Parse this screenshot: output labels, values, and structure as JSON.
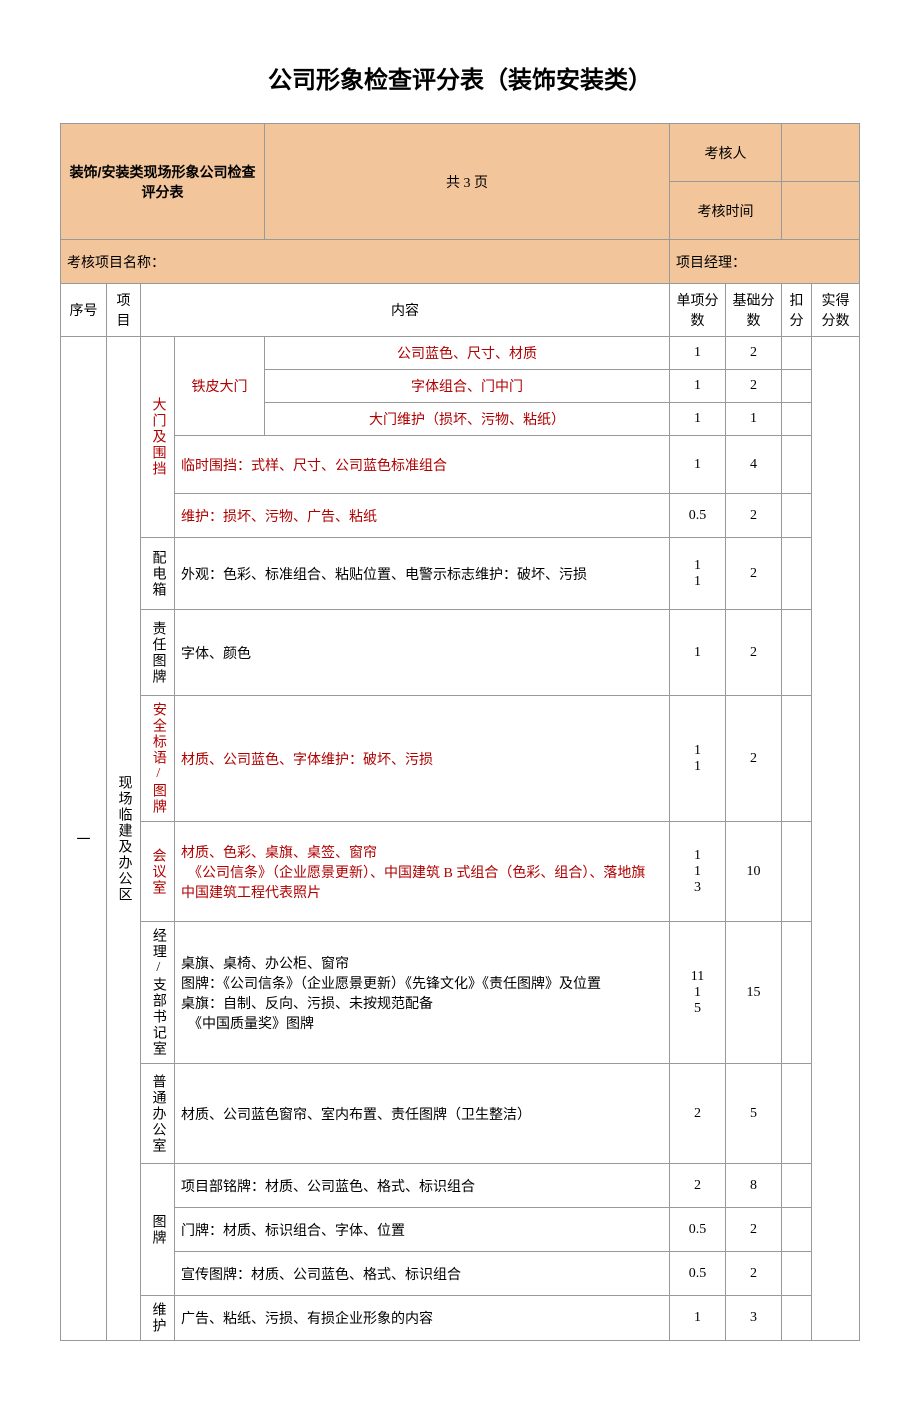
{
  "title": "公司形象检查评分表（装饰安装类）",
  "header": {
    "form_title": "装饰/安装类现场形象公司检查评分表",
    "pages": "共 3 页",
    "assessor_label": "考核人",
    "assess_time_label": "考核时间",
    "project_name_label": "考核项目名称：",
    "project_manager_label": "项目经理："
  },
  "columns": {
    "seq": "序号",
    "item": "项目",
    "content": "内容",
    "single_score": "单项分数",
    "base_score": "基础分数",
    "deduct": "扣分",
    "actual": "实得分数"
  },
  "section": {
    "seq": "一",
    "item": "现场临建及办公区",
    "rows": [
      {
        "sub": "大门及围挡",
        "label": "铁皮大门",
        "content": "公司蓝色、尺寸、材质",
        "single": "1",
        "base": "2",
        "red_label": true,
        "red_content": true
      },
      {
        "content": "字体组合、门中门",
        "single": "1",
        "base": "2",
        "red_content": true
      },
      {
        "content": "大门维护（损坏、污物、粘纸）",
        "single": "1",
        "base": "1",
        "red_content": true
      },
      {
        "content": "临时围挡：式样、尺寸、公司蓝色标准组合",
        "single": "1",
        "base": "4",
        "red_content": true
      },
      {
        "content": "维护：损坏、污物、广告、粘纸",
        "single": "0.5",
        "base": "2",
        "red_content": true
      },
      {
        "sub": "配电箱",
        "content": "外观：色彩、标准组合、粘贴位置、电警示标志维护：破坏、污损",
        "single": "1\n1",
        "base": "2"
      },
      {
        "sub": "责任图牌",
        "content": "字体、颜色",
        "single": "1",
        "base": "2"
      },
      {
        "sub": "安全标语/图牌",
        "content": "材质、公司蓝色、字体维护：破坏、污损",
        "single": "1\n1",
        "base": "2",
        "red_sub": true,
        "red_content": true
      },
      {
        "sub": "会议室",
        "content": "材质、色彩、桌旗、桌签、窗帘\n　《公司信条》（企业愿景更新）、中国建筑 B 式组合（色彩、组合）、落地旗\n中国建筑工程代表照片",
        "single": "1\n1\n3",
        "base": "10",
        "red_sub": true,
        "red_content": true
      },
      {
        "sub": "经理/支部书记室",
        "content": "桌旗、桌椅、办公柜、窗帘\n图牌：《公司信条》（企业愿景更新）《先锋文化》《责任图牌》及位置\n桌旗：自制、反向、污损、未按规范配备\n　《中国质量奖》图牌",
        "single": "11\n1\n5",
        "base": "15"
      },
      {
        "sub": "普通办公室",
        "content": "材质、公司蓝色窗帘、室内布置、责任图牌（卫生整洁）",
        "single": "2",
        "base": "5"
      },
      {
        "sub": "图牌",
        "content": "项目部铭牌：材质、公司蓝色、格式、标识组合",
        "single": "2",
        "base": "8"
      },
      {
        "content": "门牌：材质、标识组合、字体、位置",
        "single": "0.5",
        "base": "2"
      },
      {
        "content": "宣传图牌：材质、公司蓝色、格式、标识组合",
        "single": "0.5",
        "base": "2"
      },
      {
        "sub": "维护",
        "content": "广告、粘纸、污损、有损企业形象的内容",
        "single": "1",
        "base": "3"
      }
    ]
  }
}
